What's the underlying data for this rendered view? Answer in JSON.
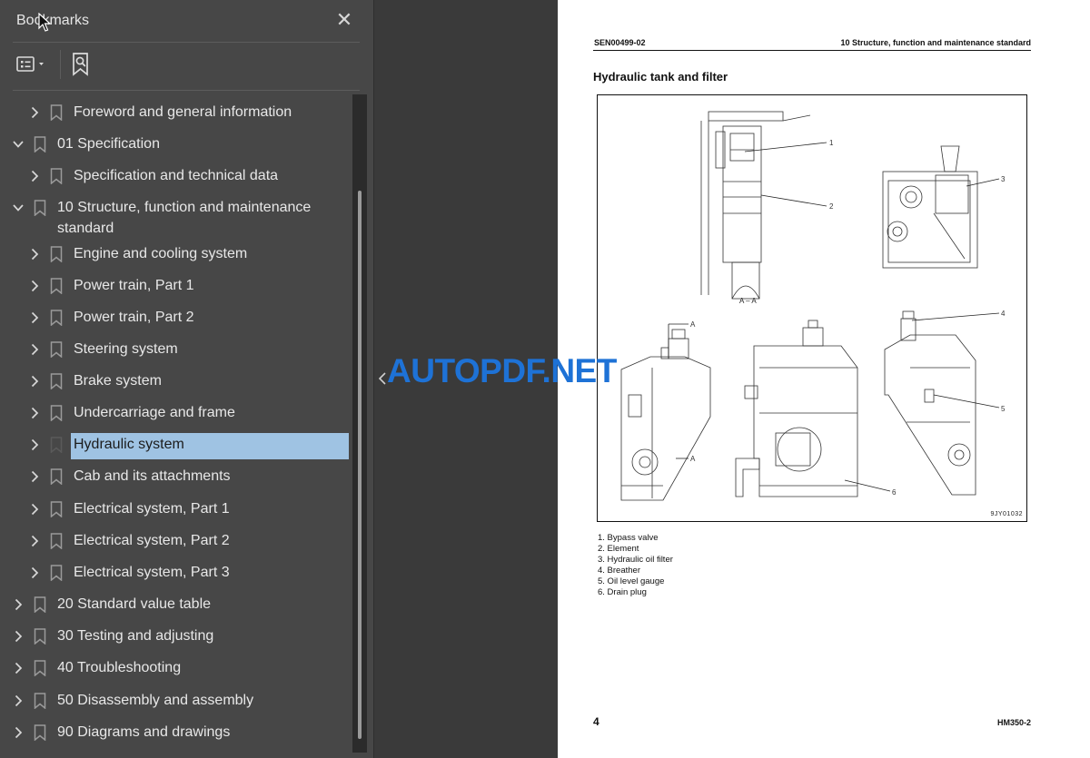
{
  "panel": {
    "title": "Bookmarks",
    "close_glyph": "✕",
    "toolbar": {
      "options_icon": "list-options-icon",
      "find_icon": "find-bookmark-icon"
    }
  },
  "bookmarks": [
    {
      "label": "Foreword and general information",
      "level": 1,
      "state": "collapsed"
    },
    {
      "label": "01 Specification",
      "level": 0,
      "state": "expanded"
    },
    {
      "label": "Specification and technical data",
      "level": 1,
      "state": "collapsed"
    },
    {
      "label": "10 Structure, function and maintenance\nstandard",
      "level": 0,
      "state": "expanded"
    },
    {
      "label": "Engine and cooling system",
      "level": 1,
      "state": "collapsed"
    },
    {
      "label": "Power train, Part 1",
      "level": 1,
      "state": "collapsed"
    },
    {
      "label": "Power train, Part 2",
      "level": 1,
      "state": "collapsed"
    },
    {
      "label": "Steering system",
      "level": 1,
      "state": "collapsed"
    },
    {
      "label": "Brake system",
      "level": 1,
      "state": "collapsed"
    },
    {
      "label": "Undercarriage and frame",
      "level": 1,
      "state": "collapsed"
    },
    {
      "label": "Hydraulic system",
      "level": 1,
      "state": "collapsed",
      "selected": true
    },
    {
      "label": "Cab and its attachments",
      "level": 1,
      "state": "collapsed"
    },
    {
      "label": "Electrical system, Part 1",
      "level": 1,
      "state": "collapsed"
    },
    {
      "label": "Electrical system, Part 2",
      "level": 1,
      "state": "collapsed"
    },
    {
      "label": "Electrical system, Part 3",
      "level": 1,
      "state": "collapsed"
    },
    {
      "label": "20 Standard value table",
      "level": 0,
      "state": "collapsed"
    },
    {
      "label": "30 Testing and adjusting",
      "level": 0,
      "state": "collapsed"
    },
    {
      "label": "40 Troubleshooting",
      "level": 0,
      "state": "collapsed"
    },
    {
      "label": "50 Disassembly and assembly",
      "level": 0,
      "state": "collapsed"
    },
    {
      "label": "90 Diagrams and drawings",
      "level": 0,
      "state": "collapsed"
    }
  ],
  "document": {
    "header_left": "SEN00499-02",
    "header_right": "10 Structure, function and maintenance standard",
    "section_title": "Hydraulic tank and filter",
    "figure": {
      "code": "9JY01032",
      "section_label": "A – A",
      "callouts": [
        "1",
        "2",
        "3",
        "4",
        "5",
        "6"
      ],
      "section_marks": [
        "A",
        "A"
      ]
    },
    "legend": [
      "1. Bypass valve",
      "2. Element",
      "3. Hydraulic oil filter",
      "4. Breather",
      "5. Oil level gauge",
      "6. Drain plug"
    ],
    "page_number": "4",
    "model": "HM350-2"
  },
  "watermark": "AUTOPDF.NET",
  "colors": {
    "selection": "#9fc3e3",
    "watermark": "#1e72d6",
    "panel_bg": "#474747"
  }
}
